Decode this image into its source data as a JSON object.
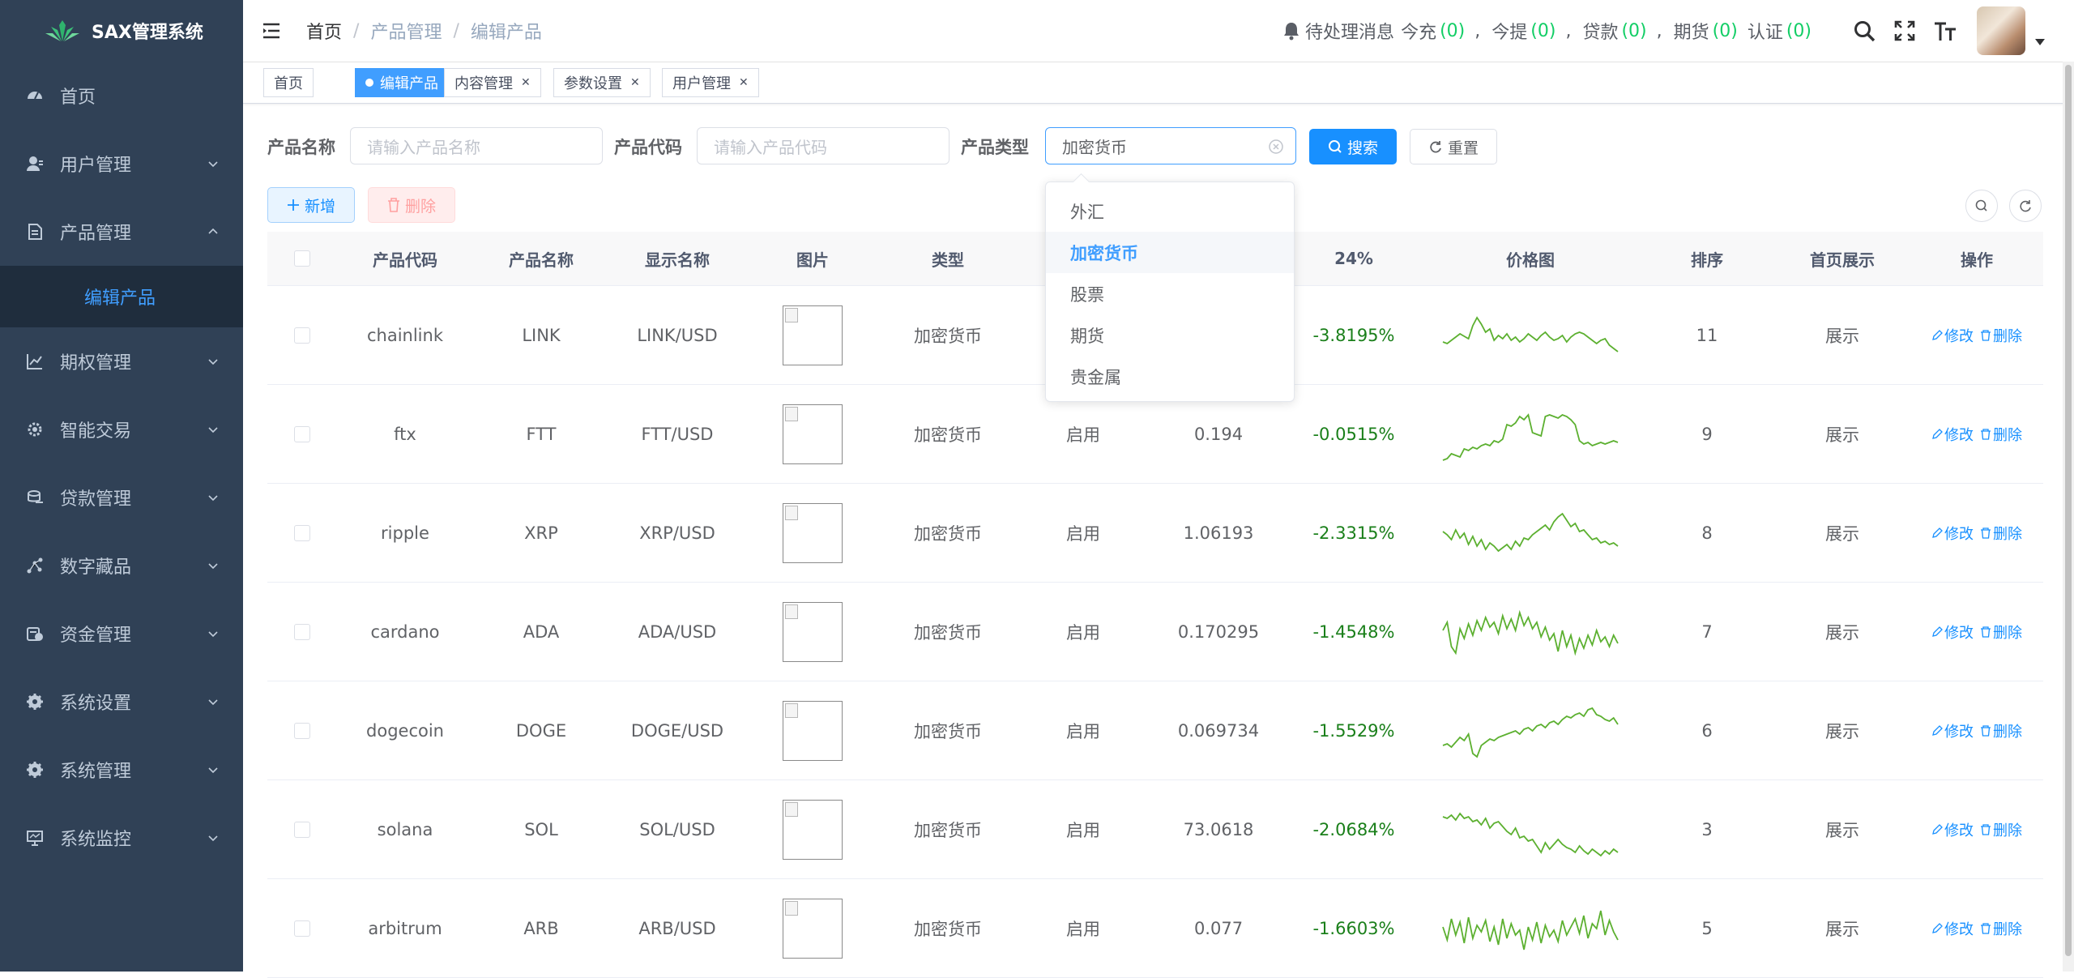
{
  "sidebar": {
    "title": "SAX管理系统",
    "items": [
      {
        "label": "首页",
        "icon": "dashboard-icon"
      },
      {
        "label": "用户管理",
        "icon": "user-icon"
      },
      {
        "label": "产品管理",
        "icon": "document-icon"
      },
      {
        "label": "期权管理",
        "icon": "chart-icon"
      },
      {
        "label": "智能交易",
        "icon": "gear-icon"
      },
      {
        "label": "贷款管理",
        "icon": "money-icon"
      },
      {
        "label": "数字藏品",
        "icon": "nodes-icon"
      },
      {
        "label": "资金管理",
        "icon": "wallet-icon"
      },
      {
        "label": "系统设置",
        "icon": "settings-icon"
      },
      {
        "label": "系统管理",
        "icon": "settings-icon"
      },
      {
        "label": "系统监控",
        "icon": "monitor-icon"
      }
    ],
    "submenu_active": "编辑产品"
  },
  "header": {
    "breadcrumb": [
      "首页",
      "产品管理",
      "编辑产品"
    ],
    "notice": {
      "label": "待处理消息",
      "items": [
        {
          "label": "今充",
          "count": "(0)"
        },
        {
          "label": "今提",
          "count": "(0)"
        },
        {
          "label": "贷款",
          "count": "(0)"
        },
        {
          "label": "期货",
          "count": "(0)"
        },
        {
          "label": "认证",
          "count": "(0)"
        }
      ]
    }
  },
  "tags": [
    {
      "label": "首页",
      "active": false
    },
    {
      "label": "编辑产品",
      "active": true
    },
    {
      "label": "内容管理",
      "active": false
    },
    {
      "label": "参数设置",
      "active": false
    },
    {
      "label": "用户管理",
      "active": false
    }
  ],
  "search": {
    "name_label": "产品名称",
    "name_placeholder": "请输入产品名称",
    "code_label": "产品代码",
    "code_placeholder": "请输入产品代码",
    "type_label": "产品类型",
    "type_value": "加密货币",
    "search_btn": "搜索",
    "reset_btn": "重置"
  },
  "toolbar": {
    "add": "新增",
    "delete": "删除"
  },
  "dropdown": {
    "options": [
      "外汇",
      "加密货币",
      "股票",
      "期货",
      "贵金属"
    ],
    "selected": "加密货币"
  },
  "table": {
    "headers": [
      "产品代码",
      "产品名称",
      "显示名称",
      "图片",
      "类型",
      "",
      "",
      "24%",
      "价格图",
      "排序",
      "首页展示",
      "操作"
    ],
    "edit_label": "修改",
    "delete_label": "删除",
    "rows": [
      {
        "code": "chainlink",
        "name": "LINK",
        "display": "LINK/USD",
        "type": "加密货币",
        "status": "",
        "price": "",
        "pct": "-3.8195%",
        "sort": "11",
        "home": "展示",
        "spark": [
          40,
          42,
          38,
          34,
          30,
          33,
          36,
          20,
          10,
          18,
          28,
          24,
          38,
          32,
          36,
          30,
          38,
          34,
          40,
          36,
          30,
          34,
          38,
          32,
          28,
          34,
          38,
          36,
          32,
          40,
          34,
          30,
          28,
          30,
          34,
          38,
          42,
          38,
          36,
          44,
          48,
          52
        ]
      },
      {
        "code": "ftx",
        "name": "FTT",
        "display": "FTT/USD",
        "type": "加密货币",
        "status": "启用",
        "price": "0.194",
        "pct": "-0.0515%",
        "sort": "9",
        "home": "展示",
        "spark": [
          64,
          62,
          56,
          58,
          60,
          50,
          52,
          48,
          50,
          46,
          44,
          46,
          40,
          42,
          38,
          20,
          22,
          18,
          10,
          14,
          8,
          30,
          32,
          34,
          10,
          8,
          10,
          12,
          8,
          10,
          14,
          20,
          40,
          44,
          42,
          46,
          44,
          42,
          44,
          42,
          40,
          42
        ]
      },
      {
        "code": "ripple",
        "name": "XRP",
        "display": "XRP/USD",
        "type": "加密货币",
        "status": "启用",
        "price": "1.06193",
        "pct": "-2.3315%",
        "sort": "8",
        "home": "展示",
        "spark": [
          30,
          34,
          40,
          28,
          38,
          32,
          46,
          36,
          48,
          40,
          52,
          44,
          48,
          54,
          50,
          46,
          52,
          42,
          48,
          38,
          40,
          34,
          30,
          26,
          22,
          28,
          18,
          12,
          8,
          16,
          24,
          20,
          30,
          28,
          34,
          40,
          38,
          44,
          42,
          46,
          44,
          48
        ]
      },
      {
        "code": "cardano",
        "name": "ADA",
        "display": "ADA/USD",
        "type": "加密货币",
        "status": "启用",
        "price": "0.170295",
        "pct": "-1.4548%",
        "sort": "7",
        "home": "展示",
        "spark": [
          30,
          20,
          50,
          58,
          28,
          40,
          22,
          36,
          18,
          30,
          14,
          26,
          20,
          34,
          12,
          28,
          16,
          30,
          8,
          24,
          14,
          28,
          20,
          38,
          26,
          42,
          34,
          56,
          30,
          50,
          36,
          58,
          40,
          52,
          36,
          48,
          30,
          44,
          38,
          50,
          36,
          46
        ]
      },
      {
        "code": "dogecoin",
        "name": "DOGE",
        "display": "DOGE/USD",
        "type": "加密货币",
        "status": "启用",
        "price": "0.069734",
        "pct": "-1.5529%",
        "sort": "6",
        "home": "展示",
        "spark": [
          50,
          48,
          52,
          46,
          40,
          44,
          36,
          60,
          64,
          50,
          46,
          42,
          44,
          40,
          38,
          36,
          34,
          32,
          36,
          30,
          28,
          32,
          26,
          24,
          28,
          22,
          20,
          24,
          18,
          14,
          16,
          12,
          10,
          14,
          6,
          4,
          12,
          14,
          18,
          20,
          16,
          24
        ]
      },
      {
        "code": "solana",
        "name": "SOL",
        "display": "SOL/USD",
        "type": "加密货币",
        "status": "启用",
        "price": "73.0618",
        "pct": "-2.0684%",
        "sort": "3",
        "home": "展示",
        "spark": [
          16,
          18,
          14,
          20,
          12,
          18,
          16,
          22,
          20,
          26,
          18,
          30,
          24,
          22,
          28,
          34,
          38,
          30,
          42,
          40,
          46,
          44,
          52,
          60,
          48,
          56,
          50,
          44,
          50,
          54,
          56,
          60,
          52,
          58,
          62,
          56,
          60,
          64,
          58,
          62,
          56,
          60
        ]
      },
      {
        "code": "arbitrum",
        "name": "ARB",
        "display": "ARB/USD",
        "type": "加密货币",
        "status": "启用",
        "price": "0.077",
        "pct": "-1.6603%",
        "sort": "5",
        "home": "展示",
        "spark": [
          30,
          46,
          20,
          40,
          24,
          50,
          18,
          44,
          28,
          36,
          22,
          48,
          30,
          52,
          20,
          44,
          26,
          40,
          34,
          58,
          30,
          46,
          24,
          50,
          28,
          42,
          34,
          48,
          22,
          40,
          30,
          20,
          38,
          16,
          44,
          26,
          32,
          10,
          40,
          22,
          36,
          46
        ]
      }
    ]
  }
}
